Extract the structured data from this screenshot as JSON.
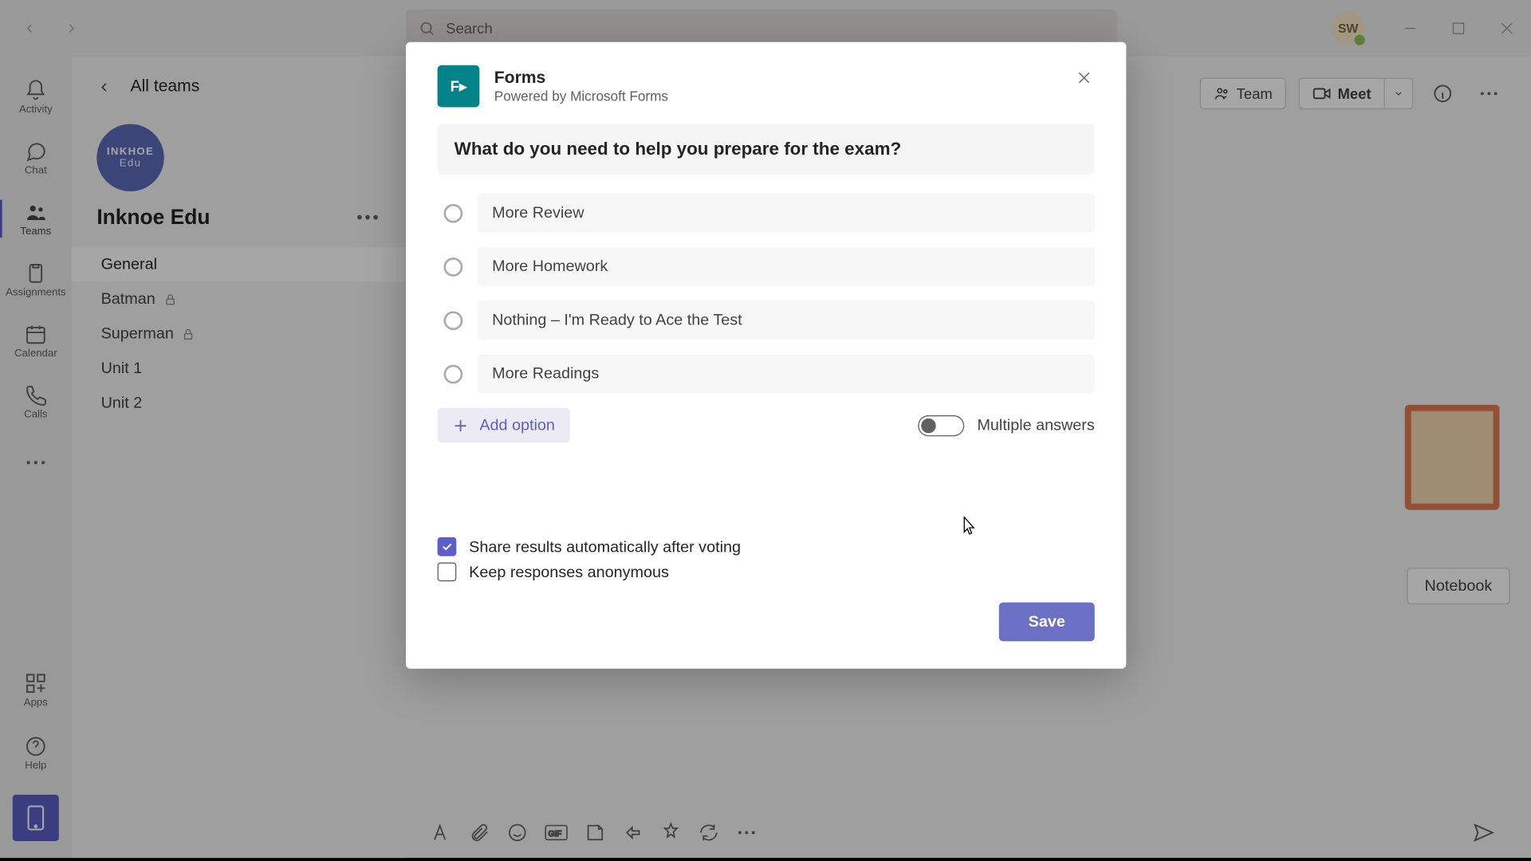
{
  "titlebar": {
    "search_placeholder": "Search",
    "avatar_initials": "SW"
  },
  "rail": {
    "items": [
      {
        "label": "Activity"
      },
      {
        "label": "Chat"
      },
      {
        "label": "Teams"
      },
      {
        "label": "Assignments"
      },
      {
        "label": "Calendar"
      },
      {
        "label": "Calls"
      }
    ],
    "apps_label": "Apps",
    "help_label": "Help"
  },
  "sidebar": {
    "all_teams": "All teams",
    "team_logo_top": "INKHOE",
    "team_logo_bottom": "Edu",
    "team_name": "Inknoe Edu",
    "channels": [
      {
        "label": "General",
        "active": true,
        "private": false
      },
      {
        "label": "Batman",
        "active": false,
        "private": true
      },
      {
        "label": "Superman",
        "active": false,
        "private": true
      },
      {
        "label": "Unit 1",
        "active": false,
        "private": false
      },
      {
        "label": "Unit 2",
        "active": false,
        "private": false
      }
    ]
  },
  "header": {
    "team_label": "Team",
    "meet_label": "Meet",
    "notebook_label": "Notebook"
  },
  "modal": {
    "app_name": "Forms",
    "powered_by": "Powered by Microsoft Forms",
    "question": "What do you need to help you prepare for the exam?",
    "options": [
      "More Review",
      "More Homework",
      "Nothing – I'm Ready to Ace the Test",
      "More Readings"
    ],
    "add_option": "Add option",
    "multiple_answers": "Multiple answers",
    "share_results": {
      "label": "Share results automatically after voting",
      "checked": true
    },
    "keep_anonymous": {
      "label": "Keep responses anonymous",
      "checked": false
    },
    "save": "Save"
  }
}
